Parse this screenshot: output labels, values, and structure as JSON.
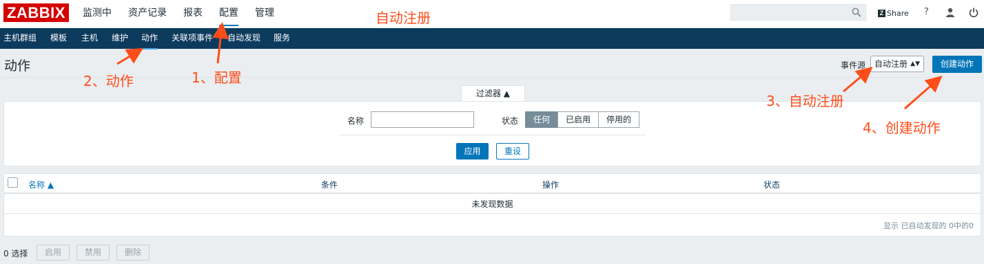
{
  "header": {
    "logo": "ZABBIX",
    "menu": [
      "监测中",
      "资产记录",
      "报表",
      "配置",
      "管理"
    ],
    "active_menu": "配置",
    "search_placeholder": "",
    "share_label": "Share",
    "help_label": "?"
  },
  "subnav": {
    "items": [
      "主机群组",
      "模板",
      "主机",
      "维护",
      "动作",
      "关联项事件",
      "自动发现",
      "服务"
    ],
    "active": "动作"
  },
  "page": {
    "title": "动作",
    "event_source_label": "事件源",
    "event_source_value": "自动注册",
    "create_button": "创建动作"
  },
  "filter": {
    "tab_label": "过滤器 ▲",
    "name_label": "名称",
    "name_value": "",
    "status_label": "状态",
    "status_options": [
      "任何",
      "已启用",
      "停用的"
    ],
    "status_selected": "任何",
    "apply_button": "应用",
    "reset_button": "重设"
  },
  "table": {
    "columns": [
      "名称 ▲",
      "条件",
      "操作",
      "状态"
    ],
    "empty_text": "未发现数据",
    "paging_text": "显示 已自动发现的 0中的0"
  },
  "footer": {
    "selected_count": "0 选择",
    "buttons": [
      "启用",
      "禁用",
      "删除"
    ]
  },
  "annotations": {
    "top": "自动注册",
    "step1": "1、配置",
    "step2": "2、动作",
    "step3": "3、自动注册",
    "step4": "4、创建动作",
    "color": "#ff4d1a"
  }
}
